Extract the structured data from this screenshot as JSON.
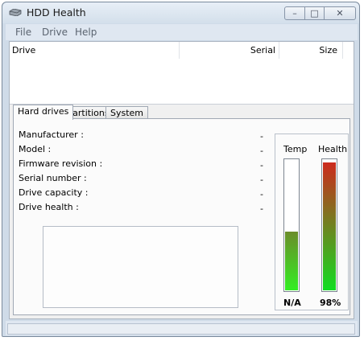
{
  "window": {
    "title": "HDD Health",
    "min_glyph": "–",
    "max_glyph": "□",
    "close_glyph": "✕"
  },
  "menu": {
    "items": [
      "File",
      "Drive",
      "Help"
    ]
  },
  "drive_list": {
    "columns": [
      "Drive",
      "Serial",
      "Size"
    ],
    "rows": []
  },
  "tabs": [
    {
      "label": "Hard drives",
      "active": true
    },
    {
      "label": "Partitions",
      "active": false
    },
    {
      "label": "System",
      "active": false
    }
  ],
  "info": {
    "labels": [
      "Manufacturer :",
      "Model :",
      "Firmware revision :",
      "Serial number :",
      "Drive capacity :",
      "Drive health :"
    ],
    "values": [
      "-",
      "-",
      "-",
      "-",
      "-",
      "-"
    ]
  },
  "gauges": {
    "temp": {
      "label": "Temp",
      "value_text": "N/A",
      "level": 0.45,
      "colors": [
        "#33ee22",
        "#6b8c2a"
      ]
    },
    "health": {
      "label": "Health",
      "value_text": "98%",
      "level": 0.98,
      "colors": [
        "#11dd22",
        "#cc2a1e"
      ]
    }
  }
}
